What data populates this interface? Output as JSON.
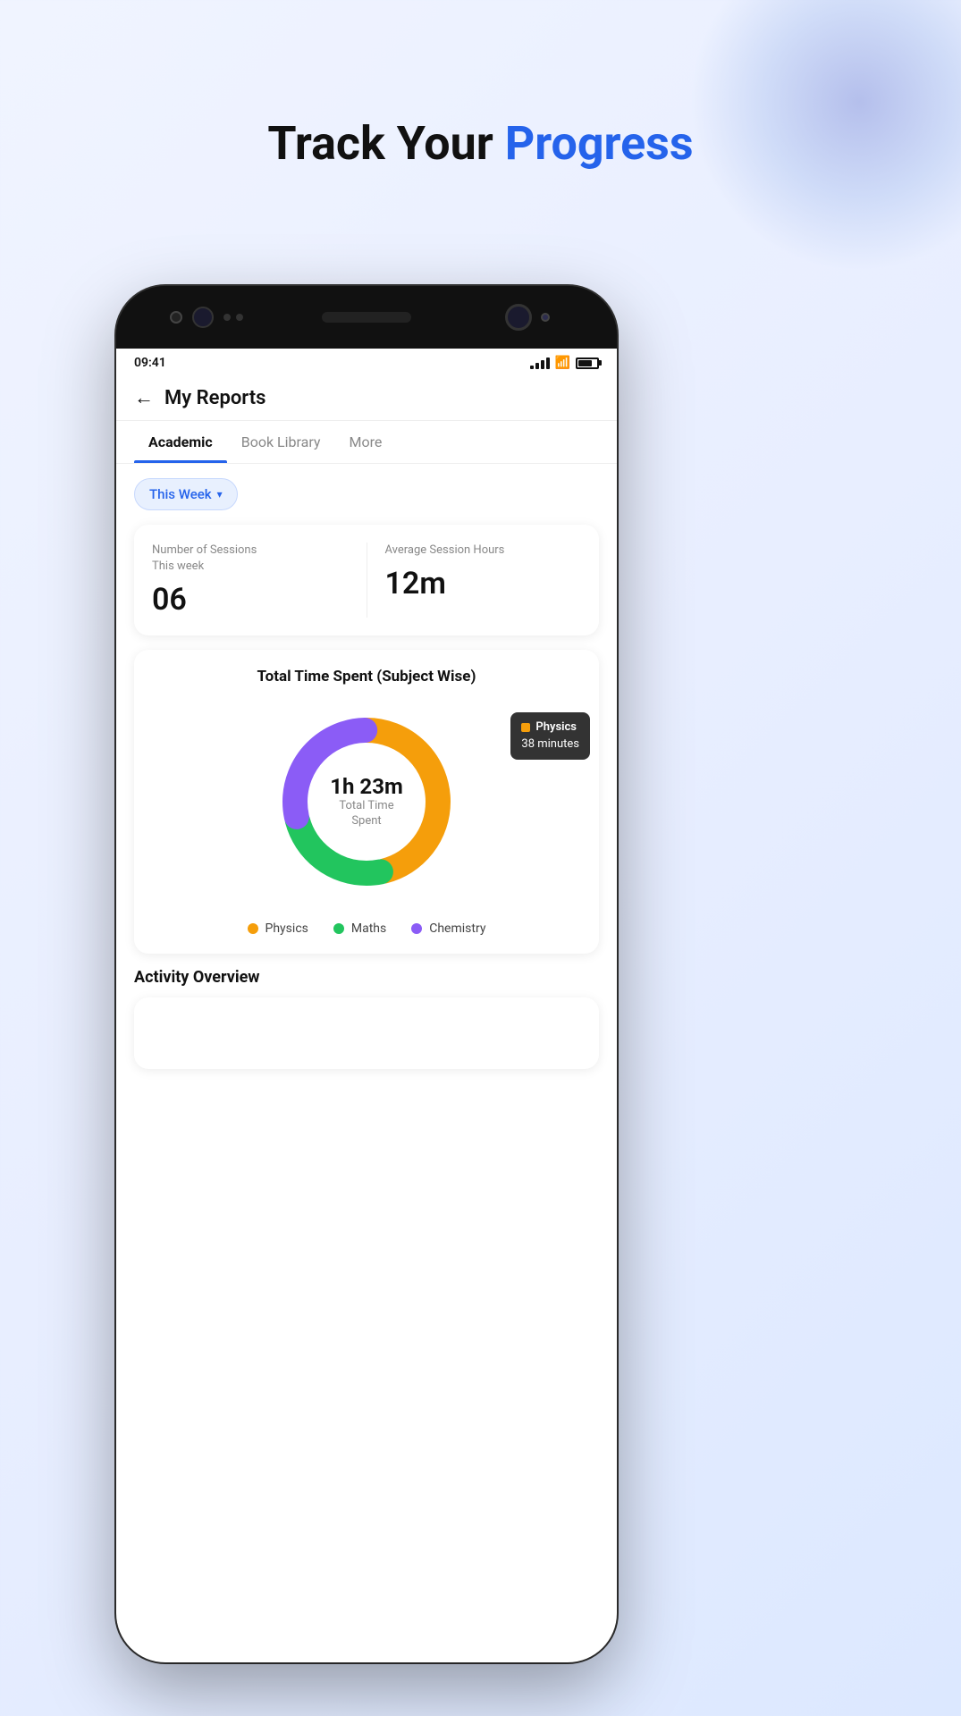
{
  "page": {
    "title_black": "Track Your ",
    "title_blue": "Progress"
  },
  "status_bar": {
    "time": "09:41",
    "signal_bars": [
      3,
      6,
      9,
      12,
      14
    ],
    "wifi": "wifi",
    "battery": "battery"
  },
  "header": {
    "back_label": "←",
    "title": "My Reports"
  },
  "tabs": [
    {
      "label": "Academic",
      "active": true
    },
    {
      "label": "Book Library",
      "active": false
    },
    {
      "label": "More",
      "active": false
    }
  ],
  "filter": {
    "label": "This Week",
    "arrow": "▾"
  },
  "stats": {
    "sessions_label": "Number of Sessions\nThis week",
    "sessions_value": "06",
    "avg_label": "Average Session Hours",
    "avg_value": "12m"
  },
  "chart": {
    "title": "Total Time Spent (Subject Wise)",
    "center_value": "1h 23m",
    "center_label": "Total Time\nSpent",
    "tooltip": {
      "subject": "Physics",
      "value": "38 minutes"
    },
    "segments": [
      {
        "subject": "Physics",
        "color": "#f59e0b",
        "percent": 46,
        "minutes": 38
      },
      {
        "subject": "Maths",
        "color": "#22c55e",
        "percent": 24,
        "minutes": 20
      },
      {
        "subject": "Chemistry",
        "color": "#8b5cf6",
        "percent": 30,
        "minutes": 25
      }
    ],
    "legend": [
      {
        "label": "Physics",
        "color": "#f59e0b"
      },
      {
        "label": "Maths",
        "color": "#22c55e"
      },
      {
        "label": "Chemistry",
        "color": "#8b5cf6"
      }
    ]
  },
  "activity": {
    "title": "Activity Overview"
  }
}
